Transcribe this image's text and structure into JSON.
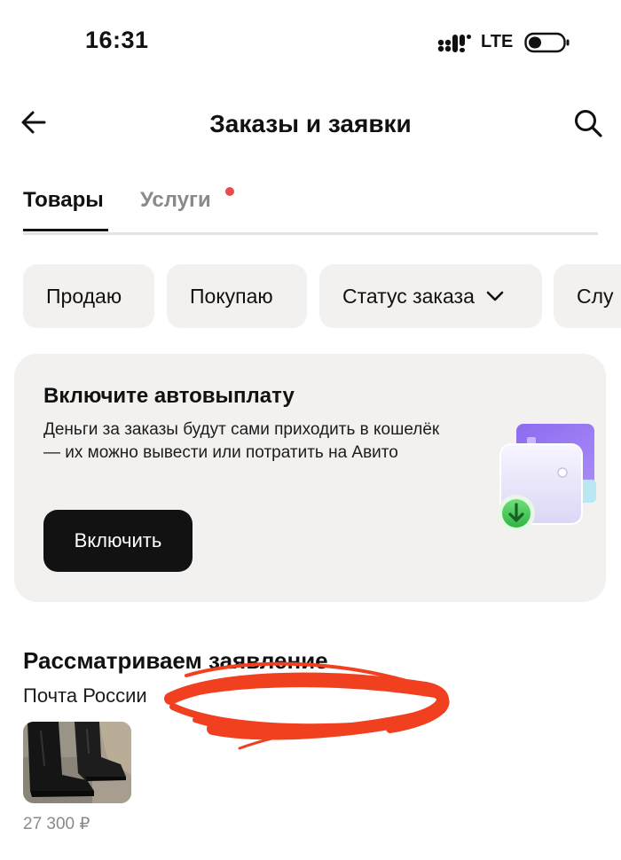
{
  "status_bar": {
    "time": "16:31",
    "network": "LTE",
    "icons": [
      "signal-icon",
      "battery-icon"
    ]
  },
  "header": {
    "title": "Заказы и заявки",
    "icons": [
      "back-arrow-icon",
      "search-icon"
    ]
  },
  "tabs": [
    {
      "label": "Товары",
      "active": true
    },
    {
      "label": "Услуги",
      "active": false,
      "has_notification_dot": true
    }
  ],
  "filters": [
    {
      "label": "Продаю"
    },
    {
      "label": "Покупаю"
    },
    {
      "label": "Статус заказа",
      "icon": "chevron-down-icon"
    },
    {
      "label": "Слу"
    }
  ],
  "banner": {
    "title": "Включите автовыплату",
    "text": "Деньги за заказы будут сами приходить в кошелёк — их можно вывести или потратить на Авито",
    "button_label": "Включить",
    "illustration": "wallet-illustration"
  },
  "order": {
    "status": "Рассматриваем заявление",
    "carrier": "Почта России",
    "price": "27 300 ₽",
    "thumbnail": "boots-thumbnail"
  },
  "colors": {
    "background": "#ffffff",
    "chip_background": "#f2f1f0",
    "button_dark": "#121212",
    "notification_dot": "#ea4b4e",
    "muted_text": "#8a8a8a",
    "scribble": "#f0401f"
  }
}
